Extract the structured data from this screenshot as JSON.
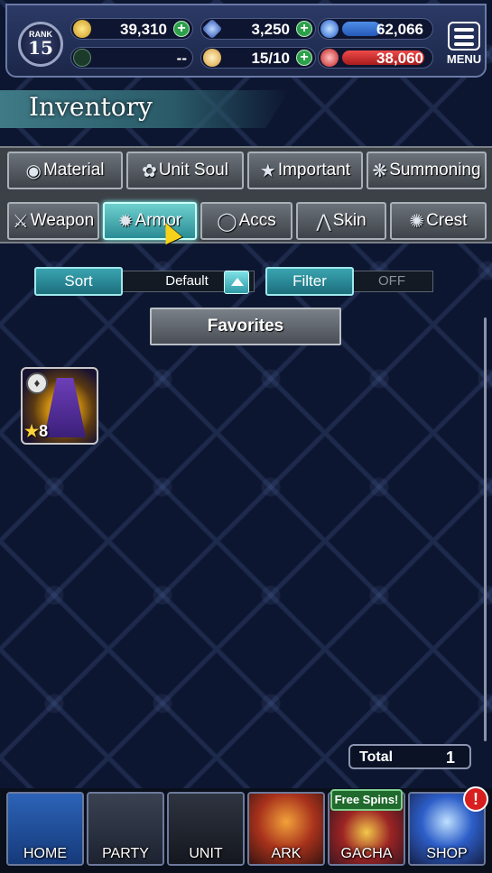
{
  "status": {
    "rank_label": "RANK",
    "rank": "15",
    "gil": "39,310",
    "lapis": "3,250",
    "blue_gauge": "62,066",
    "blue_gauge_fill": 0.45,
    "slot_a": "--",
    "energy": "15/10",
    "red_gauge": "38,060",
    "red_gauge_fill": 0.95,
    "menu_label": "MENU"
  },
  "header": {
    "title": "Inventory"
  },
  "tabs_row1": [
    {
      "label": "Material",
      "icon": "bag-icon"
    },
    {
      "label": "Unit Soul",
      "icon": "soul-icon"
    },
    {
      "label": "Important",
      "icon": "star-icon"
    },
    {
      "label": "Summoning",
      "icon": "summon-icon"
    }
  ],
  "tabs_row2": [
    {
      "label": "Weapon",
      "icon": "sword-icon"
    },
    {
      "label": "Armor",
      "icon": "armor-icon",
      "active": true
    },
    {
      "label": "Accs",
      "icon": "ring-icon"
    },
    {
      "label": "Skin",
      "icon": "hanger-icon"
    },
    {
      "label": "Crest",
      "icon": "crest-icon"
    }
  ],
  "controls": {
    "sort_label": "Sort",
    "sort_value": "Default",
    "filter_label": "Filter",
    "filter_value": "OFF",
    "favorites_label": "Favorites"
  },
  "items": [
    {
      "name": "purple robe armor",
      "rarity": "8",
      "icon": "armor-type-icon"
    }
  ],
  "total": {
    "label": "Total",
    "count": "1"
  },
  "nav": [
    {
      "label": "HOME"
    },
    {
      "label": "PARTY"
    },
    {
      "label": "UNIT"
    },
    {
      "label": "ARK"
    },
    {
      "label": "GACHA",
      "badge": "Free Spins!"
    },
    {
      "label": "SHOP",
      "alert": "!"
    }
  ],
  "colors": {
    "accent_teal": "#3aa4b0",
    "gauge_blue": "#2659b8",
    "gauge_red": "#a81b1b",
    "plus_green": "#2ca04a"
  }
}
